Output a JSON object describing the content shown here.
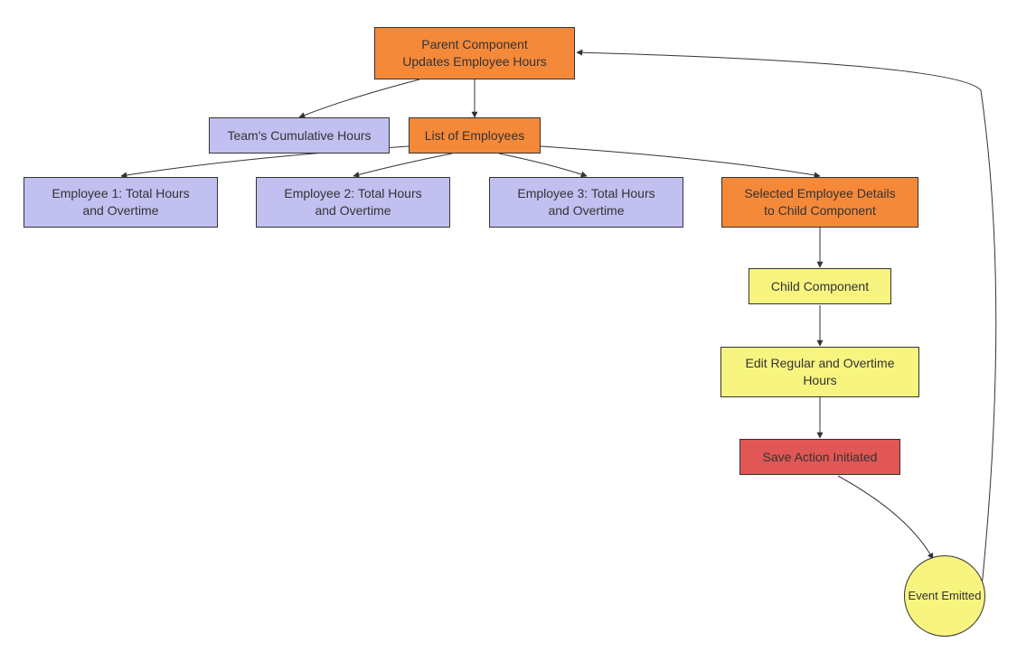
{
  "nodes": {
    "parent": {
      "line1": "Parent Component",
      "line2": "Updates Employee Hours"
    },
    "teamHours": {
      "label": "Team's Cumulative Hours"
    },
    "list": {
      "label": "List of Employees"
    },
    "emp1": {
      "line1": "Employee 1: Total Hours",
      "line2": "and Overtime"
    },
    "emp2": {
      "line1": "Employee 2: Total Hours",
      "line2": "and Overtime"
    },
    "emp3": {
      "line1": "Employee 3: Total Hours",
      "line2": "and Overtime"
    },
    "selected": {
      "line1": "Selected Employee Details",
      "line2": "to Child Component"
    },
    "child": {
      "label": "Child Component"
    },
    "edit": {
      "line1": "Edit Regular and Overtime",
      "line2": "Hours"
    },
    "save": {
      "label": "Save Action Initiated"
    },
    "event": {
      "label": "Event Emitted"
    }
  }
}
